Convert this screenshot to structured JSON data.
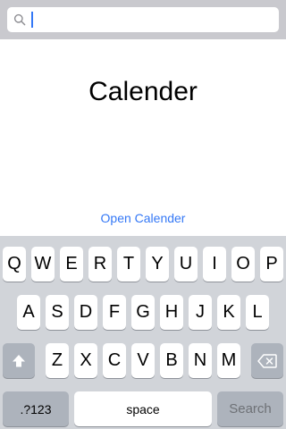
{
  "search": {
    "value": "",
    "placeholder": "",
    "icon": "search-icon"
  },
  "main": {
    "title": "Calender",
    "open_link": "Open Calender"
  },
  "keyboard": {
    "row1": [
      "Q",
      "W",
      "E",
      "R",
      "T",
      "Y",
      "U",
      "I",
      "O",
      "P"
    ],
    "row2": [
      "A",
      "S",
      "D",
      "F",
      "G",
      "H",
      "J",
      "K",
      "L"
    ],
    "row3": [
      "Z",
      "X",
      "C",
      "V",
      "B",
      "N",
      "M"
    ],
    "shift_icon": "shift-icon",
    "delete_icon": "delete-icon",
    "numbers_label": ".?123",
    "space_label": "space",
    "search_label": "Search"
  },
  "colors": {
    "accent": "#3478f6",
    "keyboard_bg": "#d1d4d9",
    "function_key": "#adb3bc"
  }
}
